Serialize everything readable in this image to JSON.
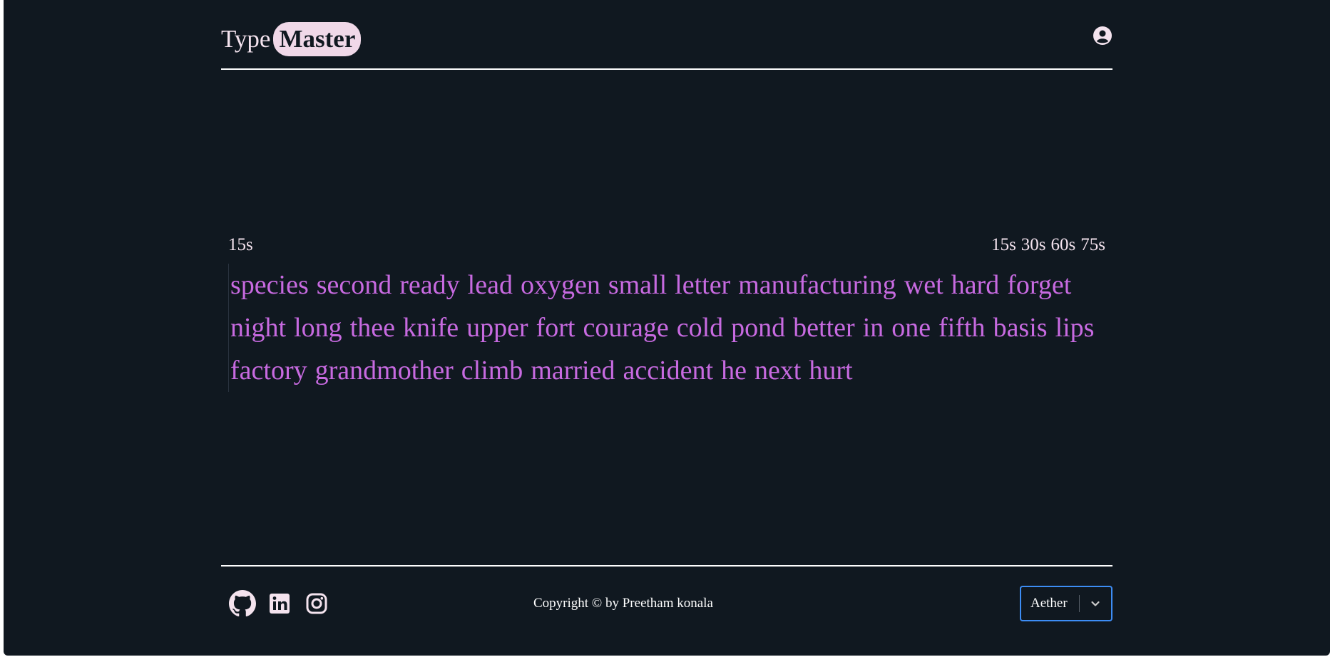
{
  "header": {
    "logo_type": "Type",
    "logo_master": "Master",
    "account_icon": "user-circle-icon"
  },
  "test": {
    "timer": "15s",
    "modes": [
      "15s",
      "30s",
      "60s",
      "75s"
    ],
    "words": [
      "species",
      "second",
      "ready",
      "lead",
      "oxygen",
      "small",
      "letter",
      "manufacturing",
      "wet",
      "hard",
      "forget",
      "night",
      "long",
      "thee",
      "knife",
      "upper",
      "fort",
      "courage",
      "cold",
      "pond",
      "better",
      "in",
      "one",
      "fifth",
      "basis",
      "lips",
      "factory",
      "grandmother",
      "climb",
      "married",
      "accident",
      "he",
      "next",
      "hurt"
    ]
  },
  "footer": {
    "social": [
      {
        "icon": "github-icon"
      },
      {
        "icon": "linkedin-icon"
      },
      {
        "icon": "instagram-icon"
      }
    ],
    "copyright": "Copyright © by Preetham konala",
    "theme": {
      "selected": "Aether",
      "dropdown_icon": "chevron-down-icon"
    }
  },
  "colors": {
    "background": "#101820",
    "text": "#f4e3ee",
    "words": "#c76ae0",
    "logo_pill": "#f0d8e8",
    "select_border": "#3d8df5"
  }
}
